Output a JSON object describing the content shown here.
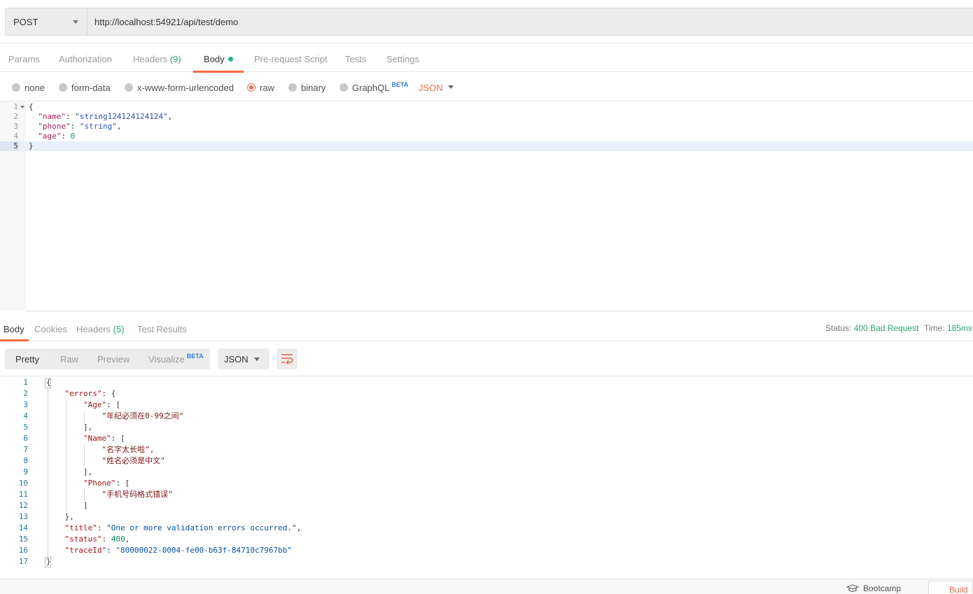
{
  "request": {
    "method": "POST",
    "url": "http://localhost:54921/api/test/demo"
  },
  "request_tabs": {
    "params": "Params",
    "authorization": "Authorization",
    "headers": "Headers",
    "headers_count": "(9)",
    "body": "Body",
    "pre_request": "Pre-request Script",
    "tests": "Tests",
    "settings": "Settings"
  },
  "body_types": {
    "none": "none",
    "form_data": "form-data",
    "urlencoded": "x-www-form-urlencoded",
    "raw": "raw",
    "binary": "binary",
    "graphql": "GraphQL",
    "graphql_badge": "BETA",
    "selected": "raw",
    "language": "JSON"
  },
  "request_body": {
    "line_numbers": [
      "1",
      "2",
      "3",
      "4",
      "5"
    ],
    "open": "{",
    "name_key": "\"name\"",
    "name_val": "\"string124124124124\"",
    "phone_key": "\"phone\"",
    "phone_val": "\"string\"",
    "age_key": "\"age\"",
    "age_val": "0",
    "close": "}"
  },
  "response_tabs": {
    "body": "Body",
    "cookies": "Cookies",
    "headers": "Headers",
    "headers_count": "(5)",
    "test_results": "Test Results",
    "status_label": "Status:",
    "status_value": "400 Bad Request",
    "time_label": "Time:",
    "time_value": "185ms"
  },
  "response_toolbar": {
    "pretty": "Pretty",
    "raw": "Raw",
    "preview": "Preview",
    "visualize": "Visualize",
    "visualize_badge": "BETA",
    "format": "JSON"
  },
  "response_body": {
    "line_numbers": [
      "1",
      "2",
      "3",
      "4",
      "5",
      "6",
      "7",
      "8",
      "9",
      "10",
      "11",
      "12",
      "13",
      "14",
      "15",
      "16",
      "17"
    ],
    "l1": "{",
    "errors_key": "\"errors\"",
    "l2_rest": ": {",
    "age_key": "\"Age\"",
    "arr_open": ": [",
    "age_msg": "\"年纪必须在0-99之间\"",
    "arr_close_comma": "],",
    "name_key": "\"Name\"",
    "name_msg1": "\"名字太长啦\"",
    "name_msg2": "\"姓名必须是中文\"",
    "phone_key": "\"Phone\"",
    "phone_msg": "\"手机号码格式错误\"",
    "arr_close": "]",
    "obj_close": "},",
    "title_key": "\"title\"",
    "title_val": "\"One or more validation errors occurred.\"",
    "status_key": "\"status\"",
    "status_val": "400",
    "trace_key": "\"traceId\"",
    "trace_val": "\"80000022-0004-fe00-b63f-84710c7967bb\"",
    "l17": "}"
  },
  "footer": {
    "bootcamp": "Bootcamp",
    "build": "Build"
  }
}
